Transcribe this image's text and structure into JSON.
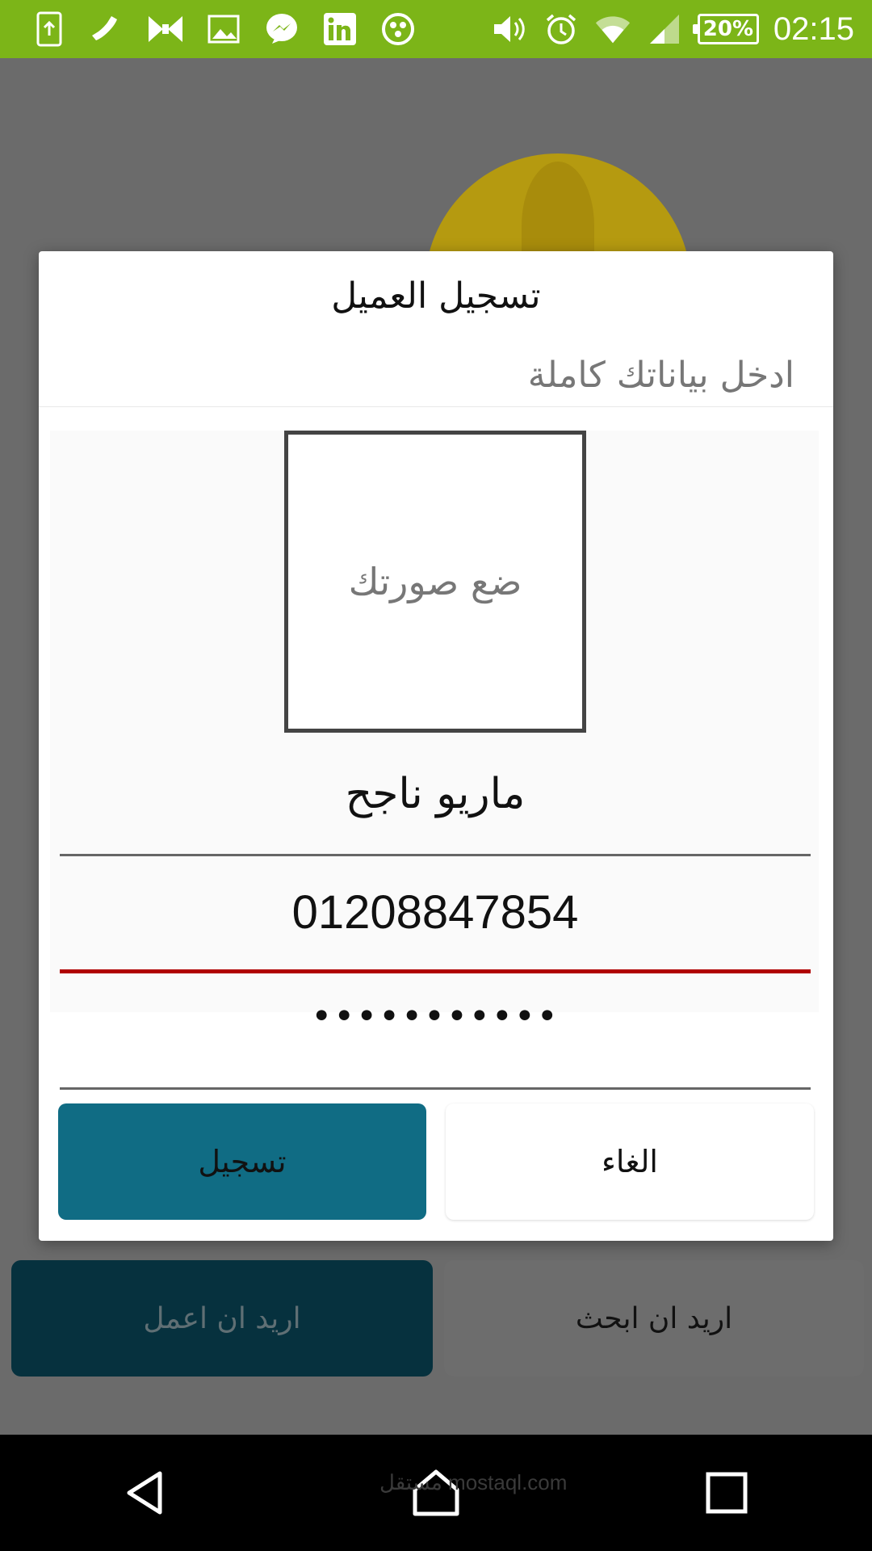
{
  "status_bar": {
    "battery": "20%",
    "time": "02:15",
    "icons": [
      "upload-icon",
      "phone-icon",
      "bow-tie-icon",
      "image-icon",
      "messenger-icon",
      "linkedin-icon",
      "dots-app-icon",
      "volume-icon",
      "alarm-icon",
      "wifi-icon",
      "signal-icon"
    ]
  },
  "background": {
    "work_button": "اريد ان اعمل",
    "search_button": "اريد ان ابحث"
  },
  "dialog": {
    "title": "تسجيل العميل",
    "subtitle": "ادخل بياناتك كاملة",
    "photo_label": "ضع صورتك",
    "name_value": "ماريو ناجح",
    "phone_value": "01208847854",
    "password_value": "•••••••••••",
    "register_button": "تسجيل",
    "cancel_button": "الغاء"
  },
  "nav": {
    "back": "back-icon",
    "home": "home-icon",
    "recents": "recents-icon"
  },
  "watermark": "مستقل mostaql.com",
  "colors": {
    "status_bar": "#7cb518",
    "register_button": "#106c84",
    "phone_underline": "#b00000"
  }
}
